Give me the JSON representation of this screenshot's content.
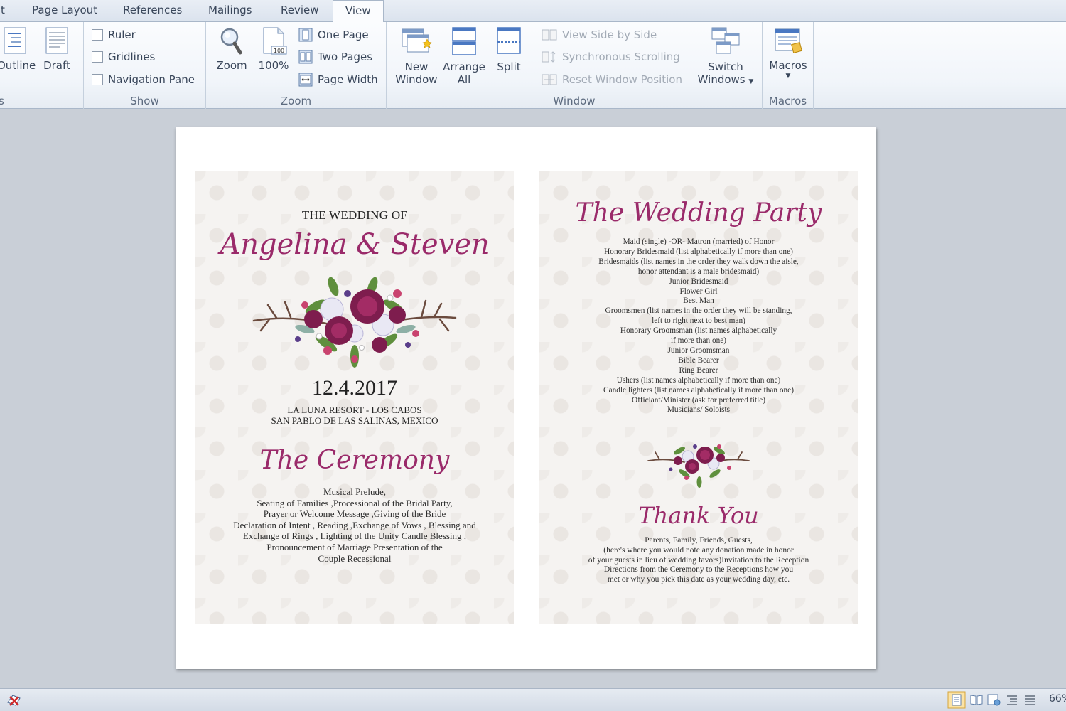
{
  "tabs": [
    {
      "label": "t",
      "active": false
    },
    {
      "label": "Page Layout",
      "active": false
    },
    {
      "label": "References",
      "active": false
    },
    {
      "label": "Mailings",
      "active": false
    },
    {
      "label": "Review",
      "active": false
    },
    {
      "label": "View",
      "active": true
    }
  ],
  "ribbon": {
    "views": {
      "outline": "Outline",
      "draft": "Draft",
      "group_label": "s"
    },
    "show": {
      "ruler": "Ruler",
      "gridlines": "Gridlines",
      "navigation_pane": "Navigation Pane",
      "group_label": "Show"
    },
    "zoom": {
      "zoom": "Zoom",
      "hundred": "100%",
      "one_page": "One Page",
      "two_pages": "Two Pages",
      "page_width": "Page Width",
      "group_label": "Zoom",
      "icon_badge": "100"
    },
    "window": {
      "new_window_1": "New",
      "new_window_2": "Window",
      "arrange_all_1": "Arrange",
      "arrange_all_2": "All",
      "split": "Split",
      "side_by_side": "View Side by Side",
      "sync_scroll": "Synchronous Scrolling",
      "reset_position": "Reset Window Position",
      "switch_1": "Switch",
      "switch_2": "Windows",
      "group_label": "Window"
    },
    "macros": {
      "macros": "Macros",
      "group_label": "Macros"
    }
  },
  "document": {
    "left": {
      "wedding_of": "THE WEDDING OF",
      "couple": "Angelina & Steven",
      "date": "12.4.2017",
      "venue": [
        "LA LUNA RESORT - LOS CABOS",
        "SAN PABLO DE LAS SALINAS, MEXICO"
      ],
      "ceremony_title": "The Ceremony",
      "ceremony_lines": [
        "Musical Prelude,",
        "Seating of Families ,Processional of the Bridal Party,",
        "Prayer or Welcome Message ,Giving of the Bride",
        "Declaration of Intent , Reading ,Exchange of Vows , Blessing and",
        "Exchange of Rings , Lighting of the Unity Candle Blessing ,",
        "Pronouncement of Marriage Presentation of the",
        "Couple Recessional"
      ]
    },
    "right": {
      "party_title": "The Wedding Party",
      "party_lines": [
        "Maid (single) -OR- Matron (married) of Honor",
        "Honorary Bridesmaid (list alphabetically if more than one)",
        "Bridesmaids (list names in the order they walk down the aisle,",
        "honor attendant is a male bridesmaid)",
        "Junior Bridesmaid",
        "Flower Girl",
        "Best Man",
        "Groomsmen (list names in the order they will be standing,",
        "left to right next to best man)",
        "Honorary Groomsman (list names alphabetically",
        "if more than one)",
        "Junior Groomsman",
        "Bible Bearer",
        "Ring Bearer",
        "Ushers (list names alphabetically if more than one)",
        "Candle lighters (list names alphabetically if more than one)",
        "Officiant/Minister (ask for preferred title)",
        "Musicians/ Soloists"
      ],
      "thanks_title": "Thank You",
      "thanks_lines": [
        "Parents, Family, Friends, Guests,",
        "(here's where you would note any donation made in honor",
        "of your guests in lieu of wedding favors)Invitation to the Reception",
        "Directions from the Ceremony to the Receptions how you",
        "met or why you pick this date as your wedding day, etc."
      ]
    }
  },
  "statusbar": {
    "zoom_percent": "66%"
  },
  "colors": {
    "accent": "#9a2a6a",
    "ribbon_bg": "#f1f5fa",
    "workspace": "#c9cfd7",
    "panel_bg": "#f5f3f1"
  }
}
